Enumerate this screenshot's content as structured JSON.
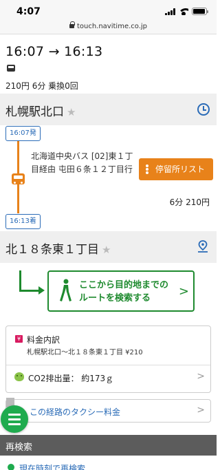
{
  "status_bar": {
    "time": "4:07"
  },
  "url_bar": {
    "domain": "touch.navitime.co.jp"
  },
  "summary": {
    "times": "16:07 → 16:13",
    "info": "210円  6分  乗換0回"
  },
  "departure": {
    "station": "札幌駅北口",
    "time_badge": "16:07発"
  },
  "segment": {
    "line_name": "北海道中央バス [02]東１丁目経由 屯田６条１２丁目行",
    "stop_list_label": "停留所リスト",
    "duration_fare": "6分  210円"
  },
  "arrival": {
    "time_badge": "16:13着",
    "station": "北１８条東１丁目"
  },
  "walk_route": {
    "label_line1": "ここから目的地までの",
    "label_line2": "ルートを検索する"
  },
  "fare": {
    "title": "料金内訳",
    "detail": "札幌駅北口〜北１８条東１丁目 ¥210",
    "co2": "CO2排出量： 約173ｇ"
  },
  "taxi": {
    "label": "この経路のタクシー料金"
  },
  "research": {
    "header": "再検索",
    "item": "現在時刻で再検索"
  },
  "colors": {
    "bus_orange": "#e8821a",
    "link_blue": "#2a6bb7",
    "walk_green": "#1e8a2e",
    "fab_green": "#1fab4e"
  }
}
